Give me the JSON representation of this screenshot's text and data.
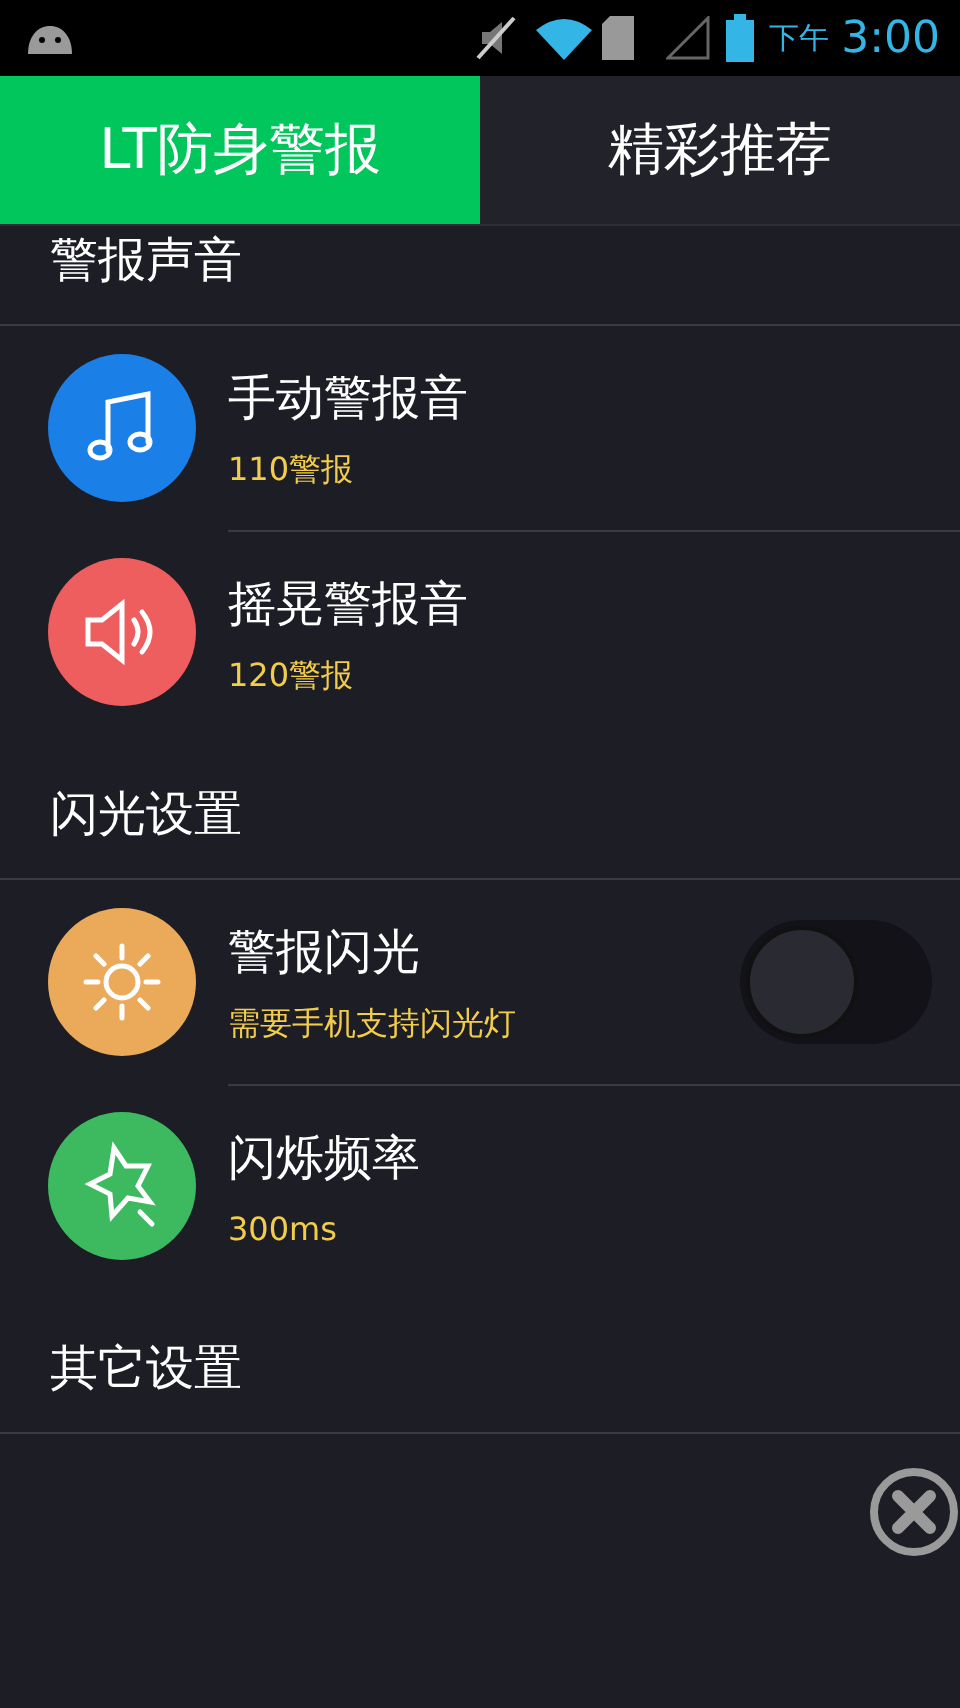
{
  "status_bar": {
    "period": "下午",
    "time": "3:00"
  },
  "tabs": [
    {
      "label": "LT防身警报",
      "selected": true
    },
    {
      "label": "精彩推荐",
      "selected": false
    }
  ],
  "sections": [
    {
      "title": "警报声音",
      "items": [
        {
          "kind": "music",
          "color": "#1a7fe6",
          "title": "手动警报音",
          "subtitle": "110警报"
        },
        {
          "kind": "speaker",
          "color": "#ee5e5e",
          "title": "摇晃警报音",
          "subtitle": "120警报"
        }
      ]
    },
    {
      "title": "闪光设置",
      "items": [
        {
          "kind": "sun",
          "color": "#eba95a",
          "title": "警报闪光",
          "subtitle": "需要手机支持闪光灯",
          "toggle": {
            "on": false
          }
        },
        {
          "kind": "star",
          "color": "#3dba5f",
          "title": "闪烁频率",
          "subtitle": "300ms"
        }
      ]
    },
    {
      "title": "其它设置"
    }
  ]
}
